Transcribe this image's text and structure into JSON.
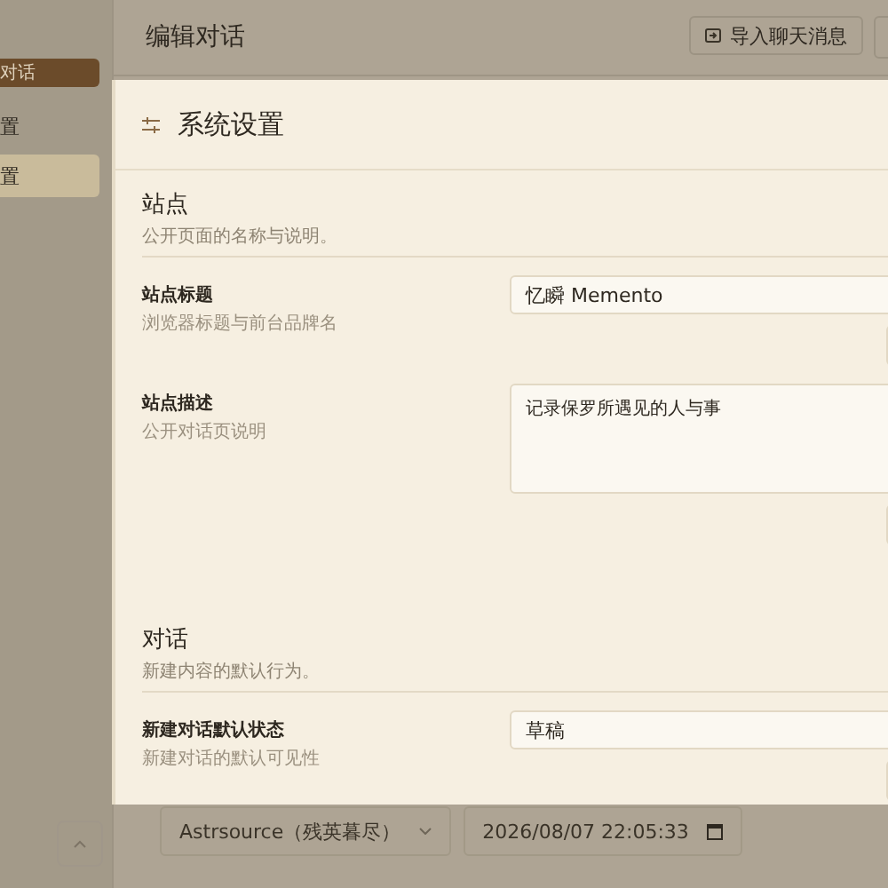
{
  "topbar": {
    "title": "编辑对话",
    "buttons": [
      {
        "label": "导入聊天消息"
      }
    ]
  },
  "sidebar": {
    "items": [
      {
        "label": "对话",
        "kind": "primary"
      },
      {
        "label": "置",
        "kind": "link",
        "selected": false
      },
      {
        "label": "置",
        "kind": "link",
        "selected": true
      }
    ]
  },
  "editor": {
    "author": "Astrsource（残英暮尽）",
    "date": "2026/08/07 22:05:33"
  },
  "modal": {
    "title": "系统设置",
    "sections": [
      {
        "title": "站点",
        "description": "公开页面的名称与说明。",
        "fields": [
          {
            "label": "站点标题",
            "hint": "浏览器标题与前台品牌名",
            "kind": "input",
            "value": "忆瞬 Memento"
          },
          {
            "label": "站点描述",
            "hint": "公开对话页说明",
            "kind": "textarea",
            "value": "记录保罗所遇见的人与事"
          }
        ]
      },
      {
        "title": "对话",
        "description": "新建内容的默认行为。",
        "fields": [
          {
            "label": "新建对话默认状态",
            "hint": "新建对话的默认可见性",
            "kind": "select",
            "value": "草稿"
          }
        ]
      }
    ]
  }
}
